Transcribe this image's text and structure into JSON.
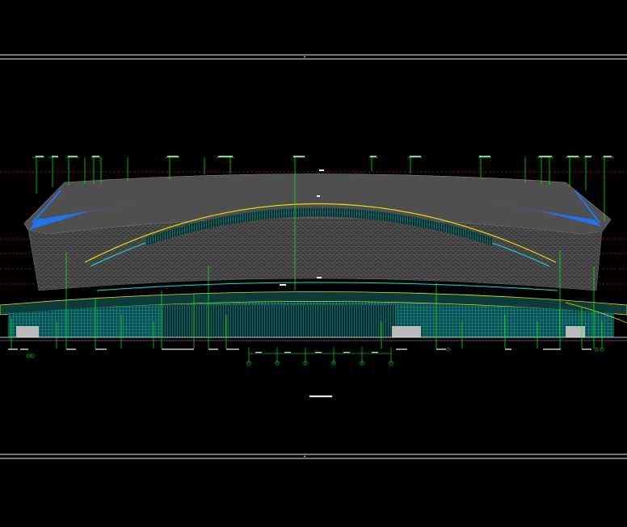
{
  "drawing": {
    "title": "",
    "background": "#000000",
    "colors": {
      "facade_grey": "#4a4a4a",
      "facade_dark": "#3a3a3a",
      "glazing_cyan": "#00e5e5",
      "eave_blue": "#1a78ff",
      "leader_green": "#00ff00",
      "datum_red": "#ff1a1a",
      "arch_yellow": "#e0e000",
      "frame_white": "#e8e8e8"
    },
    "icons": [
      "axis-bubble-icon",
      "elevation-mark-icon"
    ]
  }
}
